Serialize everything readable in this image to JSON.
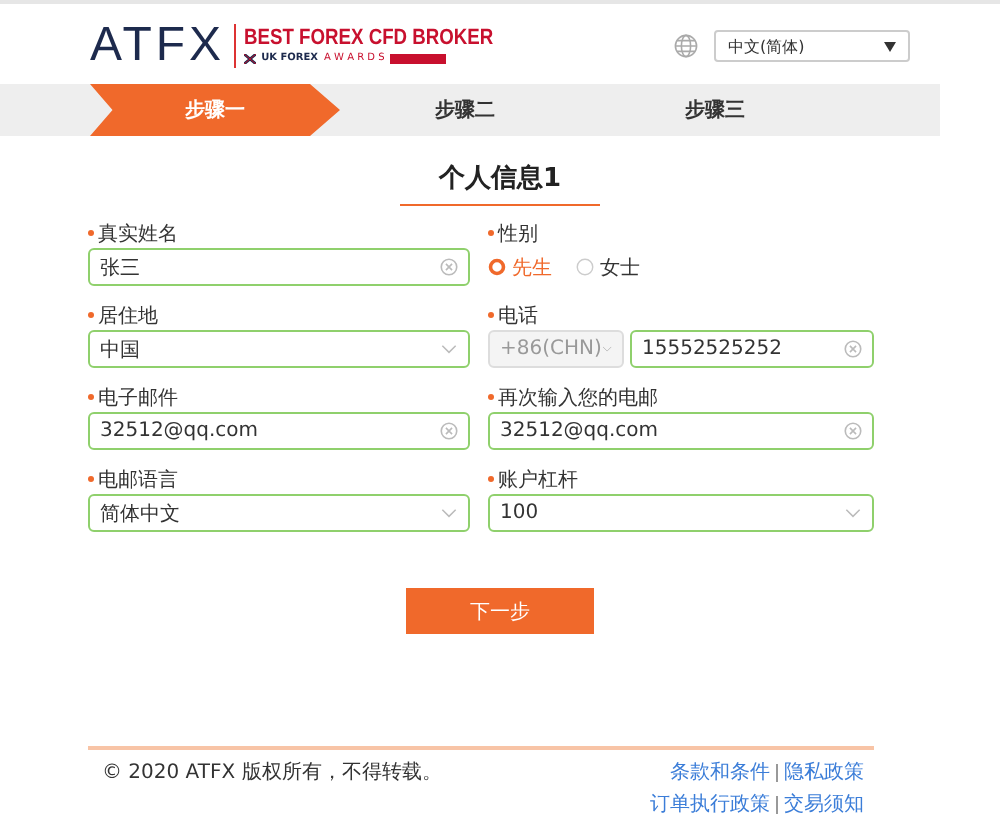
{
  "header": {
    "logo": "ATFX",
    "award_title": "BEST FOREX CFD BROKER",
    "award_org": "UK FOREX",
    "award_name": "A W A R D S",
    "language": "中文(简体)"
  },
  "steps": [
    {
      "label": "步骤一",
      "selected": true
    },
    {
      "label": "步骤二",
      "selected": false
    },
    {
      "label": "步骤三",
      "selected": false
    }
  ],
  "title": "个人信息1",
  "fields": [
    {
      "kind": "text",
      "label": "真实姓名",
      "required": true,
      "value": "张三"
    },
    {
      "kind": "radio",
      "label": "性别",
      "required": true,
      "options": [
        {
          "label": "先生",
          "selected": true
        },
        {
          "label": "女士",
          "selected": false
        }
      ]
    },
    {
      "kind": "select",
      "label": "居住地",
      "required": true,
      "value": "中国"
    },
    {
      "kind": "phone",
      "label": "电话",
      "required": true,
      "code": "+86(CHN)",
      "number": "15552525252"
    },
    {
      "kind": "text",
      "label": "电子邮件",
      "required": true,
      "value": "32512@qq.com"
    },
    {
      "kind": "text",
      "label": "再次输入您的电邮",
      "required": true,
      "value": "32512@qq.com"
    },
    {
      "kind": "select",
      "label": "电邮语言",
      "required": true,
      "value": "简体中文"
    },
    {
      "kind": "select",
      "label": "账户杠杆",
      "required": true,
      "value": "100"
    }
  ],
  "next_button": "下一步",
  "footer": {
    "copyright": "© 2020 ATFX 版权所有，不得转载。",
    "links": [
      [
        "条款和条件",
        "隐私政策"
      ],
      [
        "订单执行政策",
        "交易须知"
      ]
    ]
  }
}
